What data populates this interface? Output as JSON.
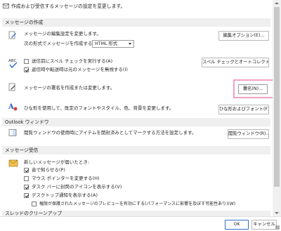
{
  "header": {
    "text": "作成および受信するメッセージの設定を変更します。"
  },
  "sections": {
    "compose": {
      "title": "メッセージの作成"
    },
    "outlook_pane": {
      "title": "Outlook ウィンドウ"
    },
    "receive": {
      "title": "メッセージ受信"
    },
    "cleanup": {
      "title": "スレッドのクリーンアップ"
    }
  },
  "compose": {
    "editor_text": "メッセージの編集設定を変更します。",
    "format_text": "次の形式でメッセージを作成する(C):",
    "format_value": "HTML 形式",
    "editor_button": "編集オプション(E)...",
    "spell_check_label": "送信前にスペル チェックを実行する(A)",
    "spell_check_checked": false,
    "ignore_original_label": "返信時や転送時は元のメッセージを無視する(I)",
    "ignore_original_checked": true,
    "spelling_button": "スペル チェックとオートコレクト(S)...",
    "signature_text": "メッセージの署名を作成または変更します。",
    "signature_button": "署名(N)...",
    "stationery_text": "ひな形を使用して、既定のフォントやスタイル、色、背景を変更します。",
    "stationery_button": "ひな形およびフォント(F)..."
  },
  "outlook_pane": {
    "reading_text": "閲覧ウィンドウの使用時にアイテムを開封済みとしてマークする方法を設定します。",
    "reading_button": "閲覧ウィンドウ(R)..."
  },
  "receive": {
    "new_message_text": "新しいメッセージが届いたとき:",
    "options": [
      {
        "label": "音で知らせる(P)",
        "checked": true
      },
      {
        "label": "マウス ポインターを変更する(H)",
        "checked": false
      },
      {
        "label": "タスク バーに封筒のアイコンを表示する(V)",
        "checked": true
      },
      {
        "label": "デスクトップ通知を表示する(A)",
        "checked": true
      },
      {
        "label": "権限が保護されたメッセージのプレビューを有効にする(パフォーマンスに影響を及ぼす可能性あり)(W)",
        "checked": false
      }
    ]
  },
  "footer": {
    "ok": "OK",
    "cancel": "キャンセル"
  }
}
